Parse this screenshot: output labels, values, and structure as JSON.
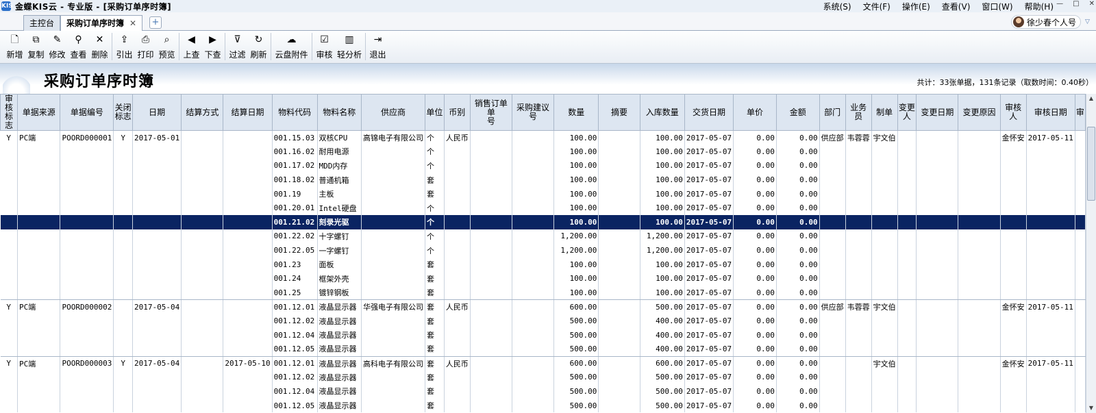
{
  "window": {
    "app_badge": "KIS",
    "title": "金蝶KIS云 - 专业版 - [采购订单序时簿]",
    "menu": [
      "系统(S)",
      "文件(F)",
      "操作(E)",
      "查看(V)",
      "窗口(W)",
      "帮助(H)"
    ],
    "controls": [
      "—",
      "□",
      "✕"
    ]
  },
  "tabs": [
    {
      "label": "主控台"
    },
    {
      "label": "采购订单序时簿",
      "active": true,
      "close": "✕"
    }
  ],
  "tab_add": "+",
  "user": {
    "name": "徐少春个人号",
    "dropdown": "▽"
  },
  "toolbar": [
    {
      "label": "新增",
      "icon": "new-doc-icon",
      "glyph": "🗋"
    },
    {
      "label": "复制",
      "icon": "copy-icon",
      "glyph": "⧉"
    },
    {
      "label": "修改",
      "icon": "edit-icon",
      "glyph": "✎"
    },
    {
      "label": "查看",
      "icon": "binoculars-icon",
      "glyph": "⚲"
    },
    {
      "label": "删除",
      "icon": "delete-icon",
      "glyph": "✕"
    },
    {
      "sep": true
    },
    {
      "label": "引出",
      "icon": "export-icon",
      "glyph": "⇪"
    },
    {
      "label": "打印",
      "icon": "print-icon",
      "glyph": "⎙"
    },
    {
      "label": "预览",
      "icon": "preview-icon",
      "glyph": "⌕"
    },
    {
      "sep": true
    },
    {
      "label": "上查",
      "icon": "trace-up-icon",
      "glyph": "◀"
    },
    {
      "label": "下查",
      "icon": "trace-down-icon",
      "glyph": "▶"
    },
    {
      "sep": true
    },
    {
      "label": "过滤",
      "icon": "filter-icon",
      "glyph": "⊽"
    },
    {
      "label": "刷新",
      "icon": "refresh-icon",
      "glyph": "↻"
    },
    {
      "sep": true
    },
    {
      "label": "云盘附件",
      "icon": "cloud-attachment-icon",
      "glyph": "☁",
      "wide": true
    },
    {
      "sep": true
    },
    {
      "label": "审核",
      "icon": "audit-icon",
      "glyph": "☑"
    },
    {
      "label": "轻分析",
      "icon": "bar-chart-icon",
      "glyph": "▥",
      "mid": true
    },
    {
      "sep": true
    },
    {
      "label": "退出",
      "icon": "exit-icon",
      "glyph": "⇥"
    }
  ],
  "report": {
    "title": "采购订单序时簿",
    "summary": "共计：33张单据，131条记录（取数时间：0.40秒）"
  },
  "columns": [
    {
      "key": "audit",
      "label": "审核\n标志",
      "align": "c"
    },
    {
      "key": "src",
      "label": "单据来源"
    },
    {
      "key": "no",
      "label": "单据编号"
    },
    {
      "key": "closed",
      "label": "关闭\n标志",
      "align": "c"
    },
    {
      "key": "date",
      "label": "日期"
    },
    {
      "key": "settle",
      "label": "结算方式"
    },
    {
      "key": "settle_date",
      "label": "结算日期"
    },
    {
      "key": "code",
      "label": "物料代码"
    },
    {
      "key": "name",
      "label": "物料名称"
    },
    {
      "key": "vendor",
      "label": "供应商"
    },
    {
      "key": "unit",
      "label": "单位"
    },
    {
      "key": "currency",
      "label": "币别"
    },
    {
      "key": "so_no",
      "label": "销售订单单\n号"
    },
    {
      "key": "advice",
      "label": "采购建议号"
    },
    {
      "key": "qty",
      "label": "数量",
      "align": "num"
    },
    {
      "key": "memo",
      "label": "摘要"
    },
    {
      "key": "in_qty",
      "label": "入库数量",
      "align": "num"
    },
    {
      "key": "deliv",
      "label": "交货日期"
    },
    {
      "key": "price",
      "label": "单价",
      "align": "num"
    },
    {
      "key": "amount",
      "label": "金额",
      "align": "num"
    },
    {
      "key": "dept",
      "label": "部门"
    },
    {
      "key": "clerk",
      "label": "业务\n员"
    },
    {
      "key": "maker",
      "label": "制单"
    },
    {
      "key": "changer",
      "label": "变更\n人"
    },
    {
      "key": "chg_date",
      "label": "变更日期"
    },
    {
      "key": "chg_reason",
      "label": "变更原因"
    },
    {
      "key": "auditor",
      "label": "审核\n人"
    },
    {
      "key": "audit_date",
      "label": "审核日期"
    },
    {
      "key": "extra",
      "label": "审"
    }
  ],
  "rows": [
    {
      "audit": "Y",
      "src": "PC端",
      "no": "POORD000001",
      "closed": "Y",
      "date": "2017-05-01",
      "code": "001.15.03",
      "name": "双核CPU",
      "vendor": "高锦电子有限公司",
      "unit": "个",
      "currency": "人民币",
      "qty": "100.00",
      "in_qty": "100.00",
      "deliv": "2017-05-07",
      "price": "0.00",
      "amount": "0.00",
      "dept": "供应部",
      "clerk": "韦蓉蓉",
      "maker": "宇文伯",
      "auditor": "金怀安",
      "audit_date": "2017-05-11"
    },
    {
      "code": "001.16.02",
      "name": "耐用电源",
      "unit": "个",
      "qty": "100.00",
      "in_qty": "100.00",
      "deliv": "2017-05-07",
      "price": "0.00",
      "amount": "0.00"
    },
    {
      "code": "001.17.02",
      "name": "MDD内存",
      "unit": "个",
      "qty": "100.00",
      "in_qty": "100.00",
      "deliv": "2017-05-07",
      "price": "0.00",
      "amount": "0.00"
    },
    {
      "code": "001.18.02",
      "name": "普通机箱",
      "unit": "套",
      "qty": "100.00",
      "in_qty": "100.00",
      "deliv": "2017-05-07",
      "price": "0.00",
      "amount": "0.00"
    },
    {
      "code": "001.19",
      "name": "主板",
      "unit": "套",
      "qty": "100.00",
      "in_qty": "100.00",
      "deliv": "2017-05-07",
      "price": "0.00",
      "amount": "0.00"
    },
    {
      "code": "001.20.01",
      "name": "Intel硬盘",
      "unit": "个",
      "qty": "100.00",
      "in_qty": "100.00",
      "deliv": "2017-05-07",
      "price": "0.00",
      "amount": "0.00"
    },
    {
      "selected": true,
      "code": "001.21.02",
      "name": "刻录光驱",
      "unit": "个",
      "qty": "100.00",
      "in_qty": "100.00",
      "deliv": "2017-05-07",
      "price": "0.00",
      "amount": "0.00"
    },
    {
      "code": "001.22.02",
      "name": "十字螺钉",
      "unit": "个",
      "qty": "1,200.00",
      "in_qty": "1,200.00",
      "deliv": "2017-05-07",
      "price": "0.00",
      "amount": "0.00"
    },
    {
      "code": "001.22.05",
      "name": "一字螺钉",
      "unit": "个",
      "qty": "1,200.00",
      "in_qty": "1,200.00",
      "deliv": "2017-05-07",
      "price": "0.00",
      "amount": "0.00"
    },
    {
      "code": "001.23",
      "name": "面板",
      "unit": "套",
      "qty": "100.00",
      "in_qty": "100.00",
      "deliv": "2017-05-07",
      "price": "0.00",
      "amount": "0.00"
    },
    {
      "code": "001.24",
      "name": "框架外壳",
      "unit": "套",
      "qty": "100.00",
      "in_qty": "100.00",
      "deliv": "2017-05-07",
      "price": "0.00",
      "amount": "0.00"
    },
    {
      "groupEnd": true,
      "code": "001.25",
      "name": "镀锌钢板",
      "unit": "套",
      "qty": "100.00",
      "in_qty": "100.00",
      "deliv": "2017-05-07",
      "price": "0.00",
      "amount": "0.00"
    },
    {
      "audit": "Y",
      "src": "PC端",
      "no": "POORD000002",
      "date": "2017-05-04",
      "code": "001.12.01",
      "name": "液晶显示器",
      "vendor": "华强电子有限公司",
      "unit": "套",
      "currency": "人民币",
      "qty": "600.00",
      "in_qty": "500.00",
      "deliv": "2017-05-07",
      "price": "0.00",
      "amount": "0.00",
      "dept": "供应部",
      "clerk": "韦蓉蓉",
      "maker": "宇文伯",
      "auditor": "金怀安",
      "audit_date": "2017-05-11"
    },
    {
      "code": "001.12.02",
      "name": "液晶显示器",
      "unit": "套",
      "qty": "500.00",
      "in_qty": "400.00",
      "deliv": "2017-05-07",
      "price": "0.00",
      "amount": "0.00"
    },
    {
      "code": "001.12.04",
      "name": "液晶显示器",
      "unit": "套",
      "qty": "500.00",
      "in_qty": "400.00",
      "deliv": "2017-05-07",
      "price": "0.00",
      "amount": "0.00"
    },
    {
      "groupEnd": true,
      "code": "001.12.05",
      "name": "液晶显示器",
      "unit": "套",
      "qty": "500.00",
      "in_qty": "400.00",
      "deliv": "2017-05-07",
      "price": "0.00",
      "amount": "0.00"
    },
    {
      "audit": "Y",
      "src": "PC端",
      "no": "POORD000003",
      "closed": "Y",
      "date": "2017-05-04",
      "settle_date": "2017-05-10",
      "code": "001.12.01",
      "name": "液晶显示器",
      "vendor": "高科电子有限公司",
      "unit": "套",
      "currency": "人民币",
      "qty": "600.00",
      "in_qty": "600.00",
      "deliv": "2017-05-07",
      "price": "0.00",
      "amount": "0.00",
      "maker": "宇文伯",
      "auditor": "金怀安",
      "audit_date": "2017-05-11"
    },
    {
      "code": "001.12.02",
      "name": "液晶显示器",
      "unit": "套",
      "qty": "500.00",
      "in_qty": "500.00",
      "deliv": "2017-05-07",
      "price": "0.00",
      "amount": "0.00"
    },
    {
      "code": "001.12.04",
      "name": "液晶显示器",
      "unit": "套",
      "qty": "500.00",
      "in_qty": "500.00",
      "deliv": "2017-05-07",
      "price": "0.00",
      "amount": "0.00"
    },
    {
      "code": "001.12.05",
      "name": "液晶显示器",
      "unit": "套",
      "qty": "500.00",
      "in_qty": "500.00",
      "deliv": "2017-05-07",
      "price": "0.00",
      "amount": "0.00"
    }
  ],
  "scrollbar": {
    "up": "▲",
    "down": "▼"
  }
}
